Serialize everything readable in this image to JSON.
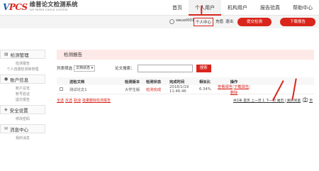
{
  "logo": {
    "mark_v": "V",
    "mark_pcs": "PCS",
    "name_cn": "维普论文检测系统",
    "name_en": "VIP PAPER CHECK SYSTEM"
  },
  "nav": {
    "items": [
      {
        "label": "首页",
        "active": false
      },
      {
        "label": "个人用户",
        "active": true
      },
      {
        "label": "机构用户",
        "active": false
      },
      {
        "label": "报告验真",
        "active": false
      },
      {
        "label": "帮助中心",
        "active": false
      }
    ]
  },
  "userbar": {
    "icon": "user-icon",
    "username": "swust001",
    "user_center": "个人中心",
    "recharge": "充值",
    "logout": "退出",
    "submit_btn": "提交检测",
    "download_btn": "下载报告"
  },
  "sidebar": {
    "groups": [
      {
        "title": "检测管理",
        "icon": "doc-icon",
        "items": [
          "检测报告",
          "个人自建检测库管理"
        ]
      },
      {
        "title": "账户信息",
        "icon": "user-icon",
        "items": [
          "账户总览",
          "账号验证",
          "提交报告"
        ]
      },
      {
        "title": "安全设置",
        "icon": "shield-icon",
        "items": [
          "修改密码"
        ]
      },
      {
        "title": "消息中心",
        "icon": "bell-icon",
        "items": [
          "我的消息"
        ]
      }
    ]
  },
  "main": {
    "title": "检测报告",
    "filter_label": "列表筛选",
    "filter_select": "文档状态 ▾",
    "search_label": "论文搜索：",
    "search_placeholder": "",
    "search_btn": "搜索",
    "columns": [
      "送检文档",
      "检测版本",
      "检测状态",
      "完成时间",
      "相似比",
      "操作"
    ],
    "rows": [
      {
        "name": "测试论文1",
        "version": "大学生版",
        "status": "检测完成",
        "time": "2018/1/19 11:46:46",
        "similarity": "6.34%",
        "op_view": "查看报告",
        "op_download": "下载报告",
        "op_delete": "删除"
      }
    ],
    "bulk": {
      "select_all": "全选",
      "invert": "反选",
      "cancel": "取消",
      "bulk_delete": "批量删除检测报告"
    },
    "pager": {
      "text": "共1条 首页 上一页 1 下一页 尾页 | 跳转到第",
      "page_input": "1",
      "suffix": "页"
    }
  },
  "colors": {
    "accent": "#d9251c",
    "brand_blue": "#1a5fa8",
    "header_pink": "#fde9e7"
  }
}
